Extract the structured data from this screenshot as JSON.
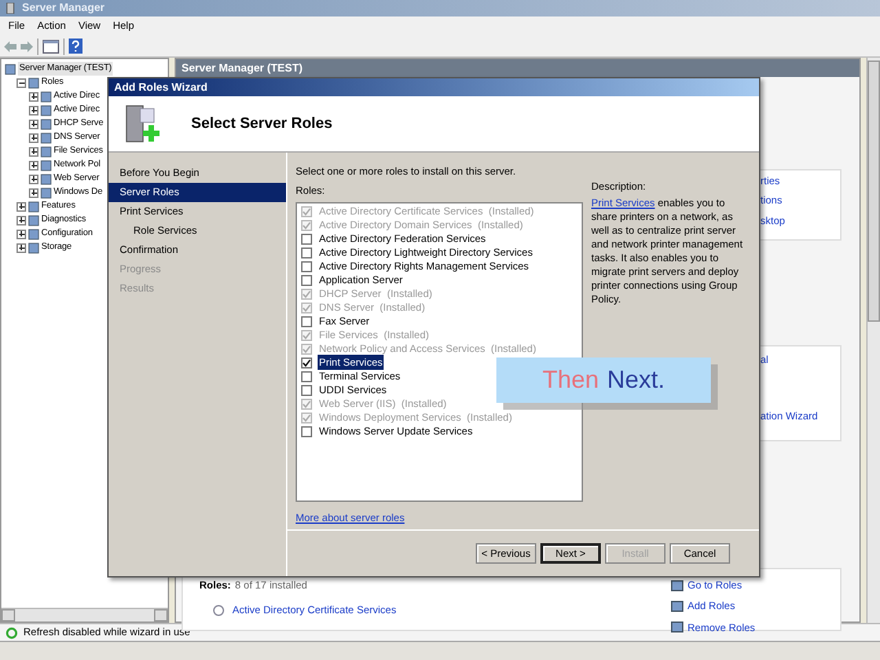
{
  "window": {
    "title": "Server Manager"
  },
  "menu": [
    "File",
    "Action",
    "View",
    "Help"
  ],
  "tree": [
    {
      "label": "Server Manager (TEST)",
      "kind": "root",
      "selected": true,
      "children": [
        {
          "label": "Roles",
          "expanded": true,
          "selected": false,
          "children": [
            {
              "label": "Active Direc",
              "expanded": false,
              "selected": false
            },
            {
              "label": "Active Direc",
              "expanded": false,
              "selected": false
            },
            {
              "label": "DHCP Serve",
              "expanded": false,
              "selected": false
            },
            {
              "label": "DNS Server",
              "expanded": false,
              "selected": false
            },
            {
              "label": "File Services",
              "expanded": false,
              "selected": false
            },
            {
              "label": "Network Pol",
              "expanded": false,
              "selected": false
            },
            {
              "label": "Web Server",
              "expanded": false,
              "selected": false
            },
            {
              "label": "Windows De",
              "expanded": false,
              "selected": false
            }
          ]
        },
        {
          "label": "Features",
          "expanded": false,
          "selected": false
        },
        {
          "label": "Diagnostics",
          "expanded": false,
          "selected": false
        },
        {
          "label": "Configuration",
          "expanded": false,
          "selected": false
        },
        {
          "label": "Storage",
          "expanded": false,
          "selected": false
        }
      ]
    }
  ],
  "pane": {
    "header": "Server Manager (TEST)",
    "links_top": [
      "rties",
      "tions",
      "sktop"
    ],
    "links_mid": [
      "al",
      "ation Wizard"
    ],
    "roles_label": "Roles:",
    "roles_count": "8 of 17 installed",
    "role_link": "Active Directory Certificate Services",
    "actions": [
      "Go to Roles",
      "Add Roles",
      "Remove Roles"
    ]
  },
  "status_bar": "Refresh disabled while wizard in use",
  "wizard": {
    "title": "Add Roles Wizard",
    "heading": "Select Server Roles",
    "steps": [
      {
        "label": "Before You Begin",
        "selected": false,
        "disabled": false
      },
      {
        "label": "Server Roles",
        "selected": true,
        "disabled": false
      },
      {
        "label": "Print Services",
        "selected": false,
        "disabled": false,
        "children": [
          {
            "label": "Role Services",
            "selected": false,
            "disabled": false
          }
        ]
      },
      {
        "label": "Confirmation",
        "selected": false,
        "disabled": false
      },
      {
        "label": "Progress",
        "selected": false,
        "disabled": true
      },
      {
        "label": "Results",
        "selected": false,
        "disabled": true
      }
    ],
    "instruction": "Select one or more roles to install on this server.",
    "roles_label": "Roles:",
    "roles": [
      {
        "label": "Active Directory Certificate Services",
        "status": "(Installed)",
        "checked": true,
        "disabled": true,
        "selected": false
      },
      {
        "label": "Active Directory Domain Services",
        "status": "(Installed)",
        "checked": true,
        "disabled": true,
        "selected": false
      },
      {
        "label": "Active Directory Federation Services",
        "checked": false,
        "disabled": false,
        "selected": false
      },
      {
        "label": "Active Directory Lightweight Directory Services",
        "checked": false,
        "disabled": false,
        "selected": false
      },
      {
        "label": "Active Directory Rights Management Services",
        "checked": false,
        "disabled": false,
        "selected": false
      },
      {
        "label": "Application Server",
        "checked": false,
        "disabled": false,
        "selected": false
      },
      {
        "label": "DHCP Server",
        "status": "(Installed)",
        "checked": true,
        "disabled": true,
        "selected": false
      },
      {
        "label": "DNS Server",
        "status": "(Installed)",
        "checked": true,
        "disabled": true,
        "selected": false
      },
      {
        "label": "Fax Server",
        "checked": false,
        "disabled": false,
        "selected": false
      },
      {
        "label": "File Services",
        "status": "(Installed)",
        "checked": true,
        "disabled": true,
        "selected": false
      },
      {
        "label": "Network Policy and Access Services",
        "status": "(Installed)",
        "checked": true,
        "disabled": true,
        "selected": false
      },
      {
        "label": "Print Services",
        "checked": true,
        "disabled": false,
        "selected": true
      },
      {
        "label": "Terminal Services",
        "checked": false,
        "disabled": false,
        "selected": false
      },
      {
        "label": "UDDI Services",
        "checked": false,
        "disabled": false,
        "selected": false
      },
      {
        "label": "Web Server (IIS)",
        "status": "(Installed)",
        "checked": true,
        "disabled": true,
        "selected": false
      },
      {
        "label": "Windows Deployment Services",
        "status": "(Installed)",
        "checked": true,
        "disabled": true,
        "selected": false
      },
      {
        "label": "Windows Server Update Services",
        "checked": false,
        "disabled": false,
        "selected": false
      }
    ],
    "description_label": "Description:",
    "description_link": "Print Services",
    "description": "enables you to share printers on a network, as well as to centralize print server and network printer management tasks. It also enables you to migrate print servers and deploy printer connections using Group Policy.",
    "more_link": "More about server roles",
    "buttons": [
      {
        "label": "< Previous",
        "disabled": false
      },
      {
        "label": "Next >",
        "disabled": false,
        "default": true
      },
      {
        "label": "Install",
        "disabled": true
      },
      {
        "label": "Cancel",
        "disabled": false
      }
    ]
  },
  "callout": {
    "first": "Then",
    "second": "Next."
  }
}
